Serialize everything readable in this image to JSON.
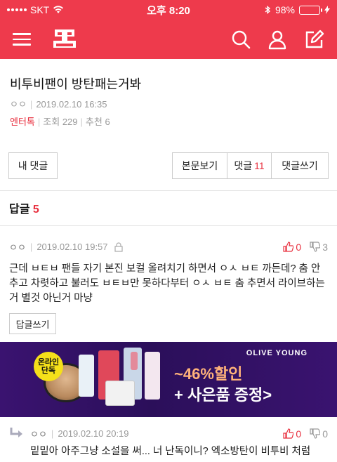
{
  "status_bar": {
    "carrier": "SKT",
    "time": "오후 8:20",
    "battery": "98%",
    "battery_level": 0.98
  },
  "nav": {
    "logo_text": "판",
    "icons": [
      "menu-icon",
      "search-icon",
      "user-icon",
      "edit-icon"
    ]
  },
  "post": {
    "title": "비투비팬이 방탄패는거봐",
    "author": "ㅇㅇ",
    "datetime": "2019.02.10 16:35",
    "category": "엔터톡",
    "views_label": "조회",
    "views": "229",
    "recommend_label": "추천",
    "recommend": "6"
  },
  "buttons": {
    "my_comments": "내 댓글",
    "view_post": "본문보기",
    "comments_label": "댓글",
    "comments_count": "11",
    "write_comment": "댓글쓰기"
  },
  "replies": {
    "label": "답글",
    "count": "5"
  },
  "comments": [
    {
      "author": "ㅇㅇ",
      "datetime": "2019.02.10 19:57",
      "up": "0",
      "down": "3",
      "text": "근데 ㅂㅌㅂ 팬들 자기 본진 보컬 올려치기 하면서 ㅇㅅ ㅂㅌ 까든데? 춤 안추고 차렷하고 불러도 ㅂㅌㅂ만 못하다부터 ㅇㅅ ㅂㅌ 춤 추면서 라이브하는거 별것 아닌거 마냥",
      "reply_button": "답글쓰기"
    },
    {
      "author": "ㅇㅇ",
      "datetime": "2019.02.10 20:19",
      "up": "0",
      "down": "0",
      "text": "밑밑아 아주그냥 소설을 써... 너 난독이니? 엑소방탄이 비투비 처럼"
    }
  ],
  "ad": {
    "badge_line1": "온라인",
    "badge_line2": "단독",
    "brand": "OLIVE YOUNG",
    "promo_line1": "~46%할인",
    "promo_line2": "+ 사은품 증정>"
  },
  "colors": {
    "brand_red": "#ee3a4c",
    "accent_red": "#e8303f",
    "ad_purple": "#2b0f5a"
  }
}
